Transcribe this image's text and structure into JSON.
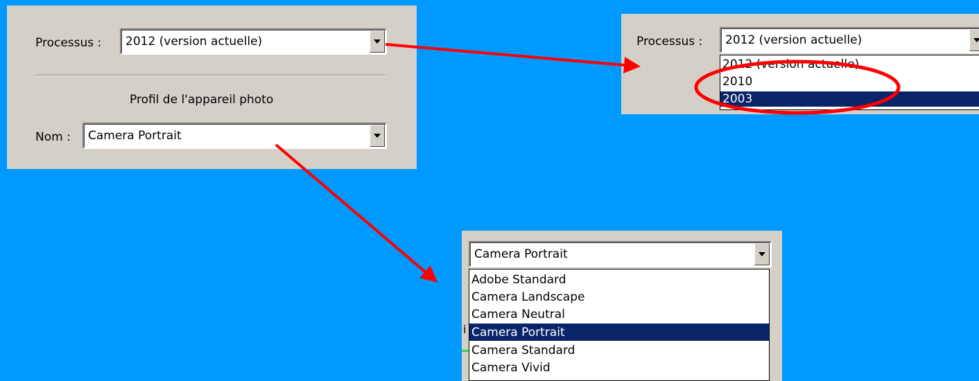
{
  "panel1": {
    "process_label": "Processus :",
    "process_value": "2012 (version actuelle)",
    "section_title": "Profil de l'appareil photo",
    "name_label": "Nom :",
    "name_value": "Camera Portrait"
  },
  "panel2": {
    "process_label": "Processus :",
    "process_value": "2012 (version actuelle)",
    "options": [
      "2012 (version actuelle)",
      "2010",
      "2003"
    ],
    "selected_index": 2
  },
  "panel3": {
    "name_value": "Camera Portrait",
    "options": [
      "Adobe Standard",
      "Camera Landscape",
      "Camera Neutral",
      "Camera Portrait",
      "Camera Standard",
      "Camera Vivid"
    ],
    "selected_index": 3,
    "behind_char": "i"
  },
  "colors": {
    "background": "#0099ff",
    "panel": "#d4d0c8",
    "selection": "#0a246a",
    "annotation": "#ff0000"
  },
  "icons": {
    "dropdown": "triangle-down-icon",
    "arrow": "red-arrow-icon",
    "highlight": "red-ellipse-icon"
  }
}
